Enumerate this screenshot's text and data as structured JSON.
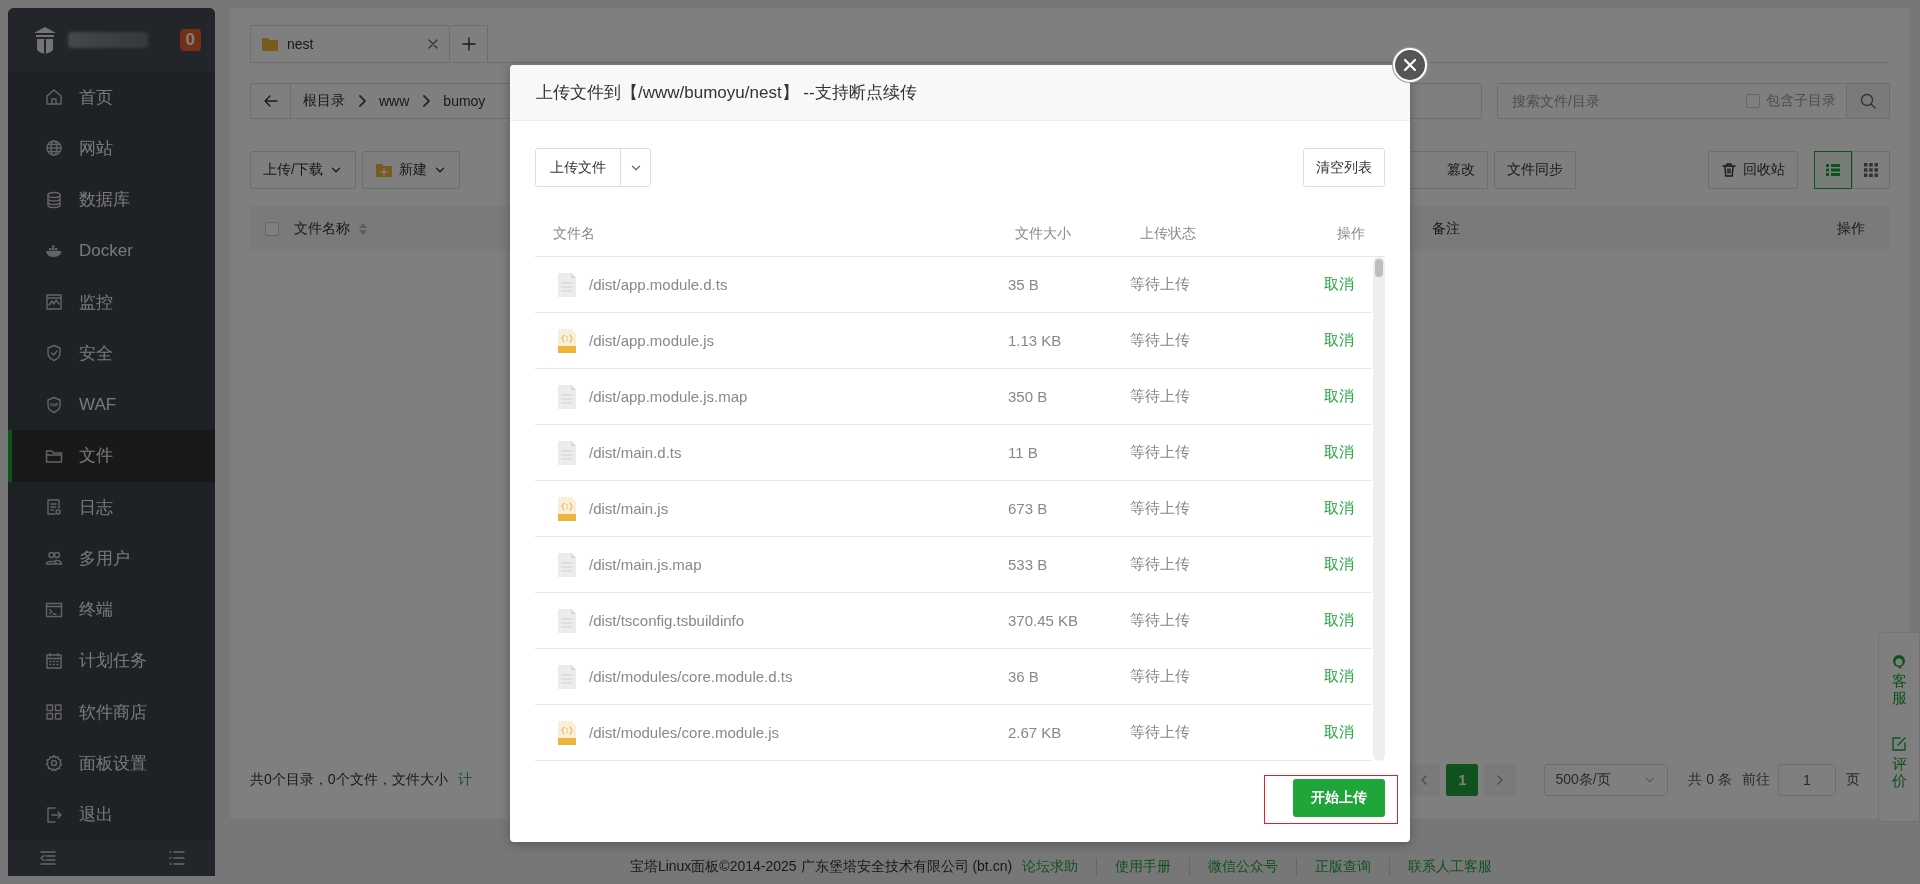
{
  "sidebar": {
    "badge": "0",
    "items": [
      {
        "label": "首页",
        "selected": false
      },
      {
        "label": "网站",
        "selected": false
      },
      {
        "label": "数据库",
        "selected": false
      },
      {
        "label": "Docker",
        "selected": false
      },
      {
        "label": "监控",
        "selected": false
      },
      {
        "label": "安全",
        "selected": false
      },
      {
        "label": "WAF",
        "selected": false
      },
      {
        "label": "文件",
        "selected": true
      },
      {
        "label": "日志",
        "selected": false
      },
      {
        "label": "多用户",
        "selected": false
      },
      {
        "label": "终端",
        "selected": false
      },
      {
        "label": "计划任务",
        "selected": false
      },
      {
        "label": "软件商店",
        "selected": false
      },
      {
        "label": "面板设置",
        "selected": false
      },
      {
        "label": "退出",
        "selected": false
      }
    ]
  },
  "files": {
    "tabs": [
      {
        "label": "nest",
        "selected": true
      }
    ],
    "breadcrumb": [
      "根目录",
      "www",
      "bumoy"
    ],
    "search": {
      "placeholder": "搜索文件/目录"
    },
    "include_subdirs": {
      "label": "包含子目录",
      "checked": false
    },
    "toolbar_left": [
      "上传/下载",
      "新建"
    ],
    "toolbar_right": [
      "篡改",
      "文件同步"
    ],
    "recycle_bin": "回收站",
    "views": [
      {
        "selected": true
      },
      {
        "selected": false
      }
    ],
    "table": {
      "select_all": {
        "checked": false
      },
      "columns": [
        "文件名称",
        "备注",
        "操作"
      ]
    },
    "status": {
      "summary": "共0个目录，0个文件，文件大小",
      "link": "计"
    },
    "pagination": {
      "pages": [
        {
          "label": "1",
          "selected": true
        }
      ],
      "page_size": "500条/页",
      "total": "共 0 条",
      "goto": "前往",
      "goto_value": "1",
      "suffix": "页"
    }
  },
  "footer": {
    "copyright": "宝塔Linux面板©2014-2025 广东堡塔安全技术有限公司 (bt.cn)",
    "links": [
      "论坛求助",
      "使用手册",
      "微信公众号",
      "正版查询",
      "联系人工客服"
    ]
  },
  "float_panel": [
    "客服",
    "评价"
  ],
  "dialog": {
    "title": "上传文件到【/www/bumoyu/nest】 --支持断点续传",
    "upload_button": "上传文件",
    "clear_button": "清空列表",
    "columns": [
      "文件名",
      "文件大小",
      "上传状态",
      "操作"
    ],
    "files": [
      {
        "kind": "text",
        "name": "/dist/app.module.d.ts",
        "size": "35 B",
        "status": "等待上传",
        "action": "取消"
      },
      {
        "kind": "js",
        "name": "/dist/app.module.js",
        "size": "1.13 KB",
        "status": "等待上传",
        "action": "取消"
      },
      {
        "kind": "text",
        "name": "/dist/app.module.js.map",
        "size": "350 B",
        "status": "等待上传",
        "action": "取消"
      },
      {
        "kind": "text",
        "name": "/dist/main.d.ts",
        "size": "11 B",
        "status": "等待上传",
        "action": "取消"
      },
      {
        "kind": "js",
        "name": "/dist/main.js",
        "size": "673 B",
        "status": "等待上传",
        "action": "取消"
      },
      {
        "kind": "text",
        "name": "/dist/main.js.map",
        "size": "533 B",
        "status": "等待上传",
        "action": "取消"
      },
      {
        "kind": "text",
        "name": "/dist/tsconfig.tsbuildinfo",
        "size": "370.45 KB",
        "status": "等待上传",
        "action": "取消"
      },
      {
        "kind": "text",
        "name": "/dist/modules/core.module.d.ts",
        "size": "36 B",
        "status": "等待上传",
        "action": "取消"
      },
      {
        "kind": "js",
        "name": "/dist/modules/core.module.js",
        "size": "2.67 KB",
        "status": "等待上传",
        "action": "取消"
      }
    ],
    "start_button": {
      "label": "开始上传",
      "highlighted": true
    }
  }
}
